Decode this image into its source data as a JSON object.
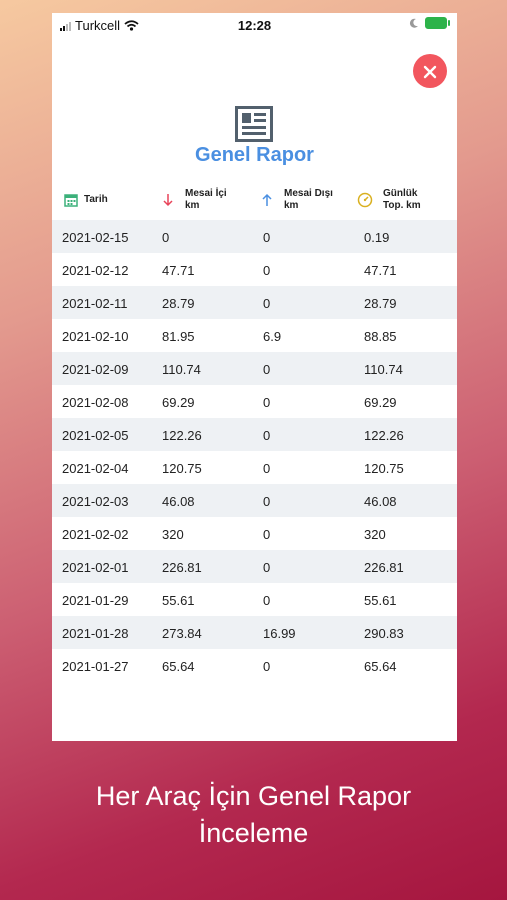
{
  "status": {
    "carrier": "Turkcell",
    "time": "12:28"
  },
  "title": "Genel Rapor",
  "columns": [
    {
      "line1": "Tarih",
      "line2": ""
    },
    {
      "line1": "Mesai İçi",
      "line2": "km"
    },
    {
      "line1": "Mesai Dışı",
      "line2": "km"
    },
    {
      "line1": "Günlük",
      "line2": "Top. km"
    }
  ],
  "rows": [
    [
      "2021-02-15",
      "0",
      "0",
      "0.19"
    ],
    [
      "2021-02-12",
      "47.71",
      "0",
      "47.71"
    ],
    [
      "2021-02-11",
      "28.79",
      "0",
      "28.79"
    ],
    [
      "2021-02-10",
      "81.95",
      "6.9",
      "88.85"
    ],
    [
      "2021-02-09",
      "110.74",
      "0",
      "110.74"
    ],
    [
      "2021-02-08",
      "69.29",
      "0",
      "69.29"
    ],
    [
      "2021-02-05",
      "122.26",
      "0",
      "122.26"
    ],
    [
      "2021-02-04",
      "120.75",
      "0",
      "120.75"
    ],
    [
      "2021-02-03",
      "46.08",
      "0",
      "46.08"
    ],
    [
      "2021-02-02",
      "320",
      "0",
      "320"
    ],
    [
      "2021-02-01",
      "226.81",
      "0",
      "226.81"
    ],
    [
      "2021-01-29",
      "55.61",
      "0",
      "55.61"
    ],
    [
      "2021-01-28",
      "273.84",
      "16.99",
      "290.83"
    ],
    [
      "2021-01-27",
      "65.64",
      "0",
      "65.64"
    ]
  ],
  "caption": {
    "line1": "Her Araç İçin Genel Rapor",
    "line2": "İnceleme"
  },
  "icons": [
    "report-icon",
    "calendar-icon",
    "arrow-down-icon",
    "arrow-up-icon",
    "speedometer-icon",
    "close-icon",
    "wifi-icon",
    "moon-icon",
    "battery-icon"
  ],
  "colors": {
    "accent": "#4a8fe1",
    "close": "#f2565e",
    "down": "#e8445a",
    "up": "#4a8fe1",
    "calendar": "#3bb07a",
    "gauge": "#d9b020"
  }
}
